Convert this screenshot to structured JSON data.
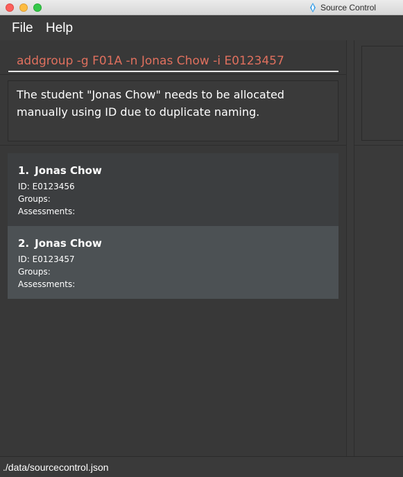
{
  "window": {
    "title": "Source Control"
  },
  "menu": {
    "file_label": "File",
    "help_label": "Help"
  },
  "command": {
    "value": "addgroup -g F01A -n Jonas Chow -i E0123457"
  },
  "result": {
    "message": "The student \"Jonas Chow\" needs to be allocated manually using ID due to duplicate naming."
  },
  "students": [
    {
      "index": "1.",
      "name": "Jonas Chow",
      "id_line": "ID: E0123456",
      "groups_line": "Groups:",
      "assessments_line": "Assessments:"
    },
    {
      "index": "2.",
      "name": "Jonas Chow",
      "id_line": "ID: E0123457",
      "groups_line": "Groups:",
      "assessments_line": "Assessments:"
    }
  ],
  "status": {
    "path": "./data/sourcecontrol.json"
  },
  "colors": {
    "command_text": "#e0705e",
    "card_selected": "#4c5154",
    "card_default": "#3c3e40"
  },
  "icons": {
    "app_icon": "source-control-app-icon"
  }
}
